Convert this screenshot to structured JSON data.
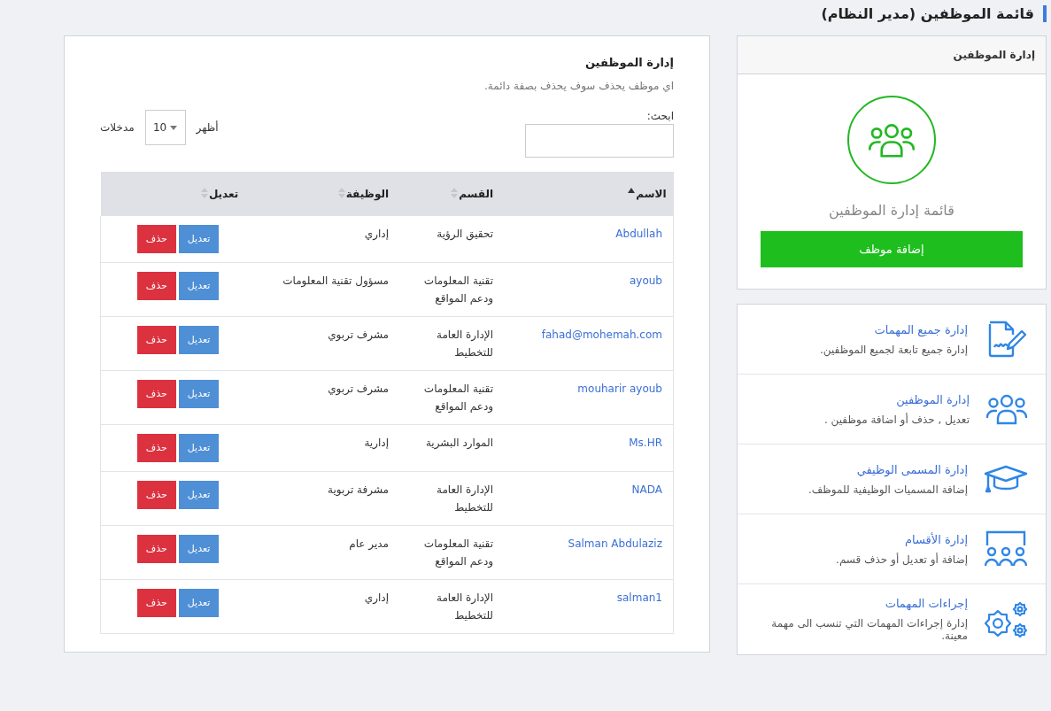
{
  "page_title": "قائمة الموظفين (مدير النظام)",
  "main": {
    "heading": "إدارة الموظفين",
    "note": "اي موظف يحذف سوف يحذف بصفة دائمة.",
    "search": {
      "label": "ابحث:"
    },
    "length": {
      "show": "أظهر",
      "value": "10",
      "entries": "مدخلات"
    },
    "table": {
      "columns": [
        {
          "label": "الاسم",
          "sorted": true
        },
        {
          "label": "القسم",
          "sorted": false
        },
        {
          "label": "الوظيفة",
          "sorted": false
        },
        {
          "label": "تعديل",
          "sorted": false
        }
      ],
      "rows": [
        {
          "name": "Abdullah",
          "department": "تحقيق الرؤية",
          "job": "إداري",
          "edit": "تعديل",
          "delete": "حذف"
        },
        {
          "name": "ayoub",
          "department": "تقنية المعلومات ودعم المواقع",
          "job": "مسؤول تقنية المعلومات",
          "edit": "تعديل",
          "delete": "حذف"
        },
        {
          "name": "fahad@mohemah.com",
          "department": "الإدارة العامة للتخطيط",
          "job": "مشرف تربوي",
          "edit": "تعديل",
          "delete": "حذف"
        },
        {
          "name": "mouharir ayoub",
          "department": "تقنية المعلومات ودعم المواقع",
          "job": "مشرف تربوي",
          "edit": "تعديل",
          "delete": "حذف"
        },
        {
          "name": "Ms.HR",
          "department": "الموارد البشرية",
          "job": "إدارية",
          "edit": "تعديل",
          "delete": "حذف"
        },
        {
          "name": "NADA",
          "department": "الإدارة العامة للتخطيط",
          "job": "مشرفة تربوية",
          "edit": "تعديل",
          "delete": "حذف"
        },
        {
          "name": "Salman Abdulaziz",
          "department": "تقنية المعلومات ودعم المواقع",
          "job": "مدير عام",
          "edit": "تعديل",
          "delete": "حذف"
        },
        {
          "name": "salman1",
          "department": "الإدارة العامة للتخطيط",
          "job": "إداري",
          "edit": "تعديل",
          "delete": "حذف"
        }
      ]
    }
  },
  "sidebar": {
    "card": {
      "header": "إدارة الموظفين",
      "title": "قائمة إدارة الموظفين",
      "button": "إضافة موظف"
    },
    "links": [
      {
        "kind": "document",
        "title": "إدارة جميع المهمات",
        "description": "إدارة جميع تابعة لجميع الموظفين."
      },
      {
        "kind": "people",
        "title": "إدارة الموظفين",
        "description": "تعديل , حذف أو اضافة موظفين ."
      },
      {
        "kind": "cap",
        "title": "إدارة المسمى الوظيفي",
        "description": "إضافة المسميات الوظيفية للموظف."
      },
      {
        "kind": "board",
        "title": "إدارة الأقسام",
        "description": "إضافة أو تعديل أو حذف قسم."
      },
      {
        "kind": "gears",
        "title": "إجراءات المهمات",
        "description": "إدارة إجراءات المهمات التي تنسب الى مهمة معينة."
      }
    ]
  }
}
